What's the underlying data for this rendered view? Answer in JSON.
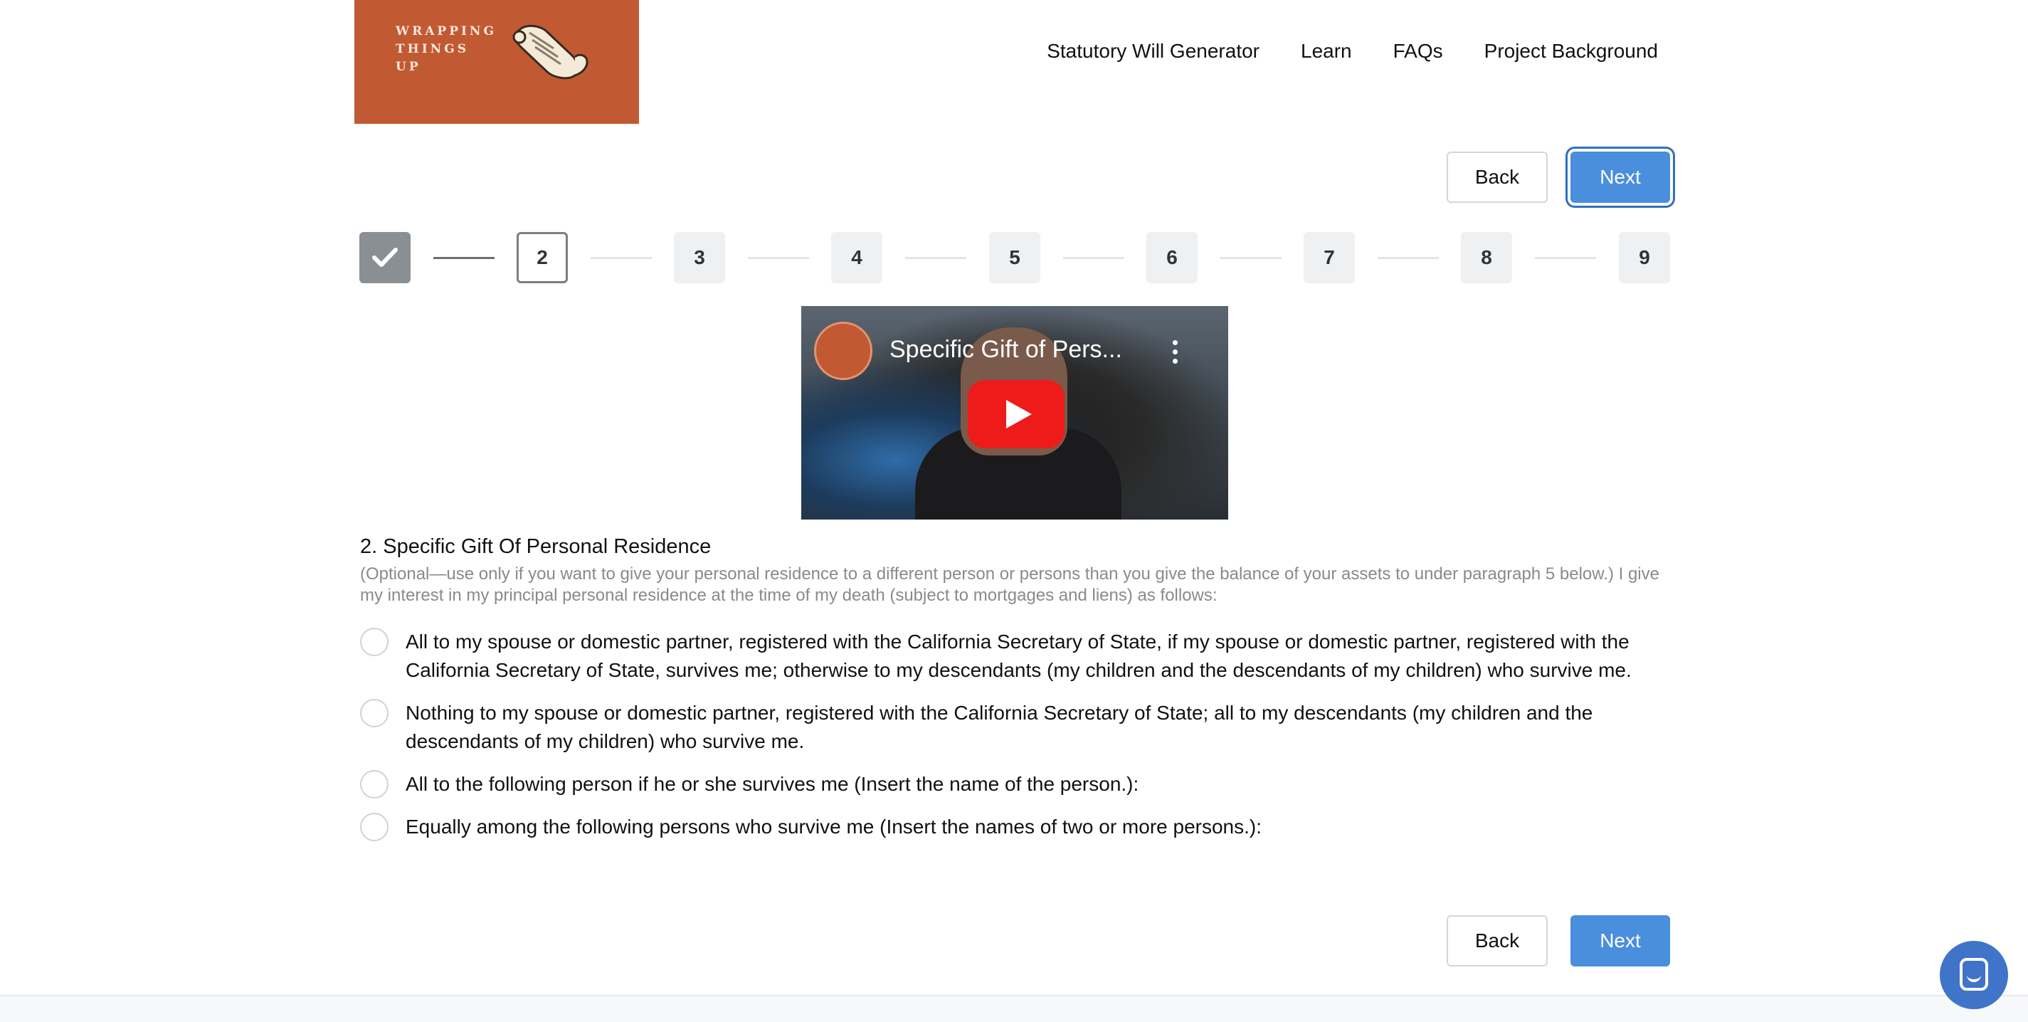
{
  "logo": {
    "line1": "WRAPPING",
    "line2": "THINGS",
    "line3": "UP"
  },
  "nav": {
    "items": [
      {
        "label": "Statutory Will Generator"
      },
      {
        "label": "Learn"
      },
      {
        "label": "FAQs"
      },
      {
        "label": "Project Background"
      }
    ]
  },
  "buttons": {
    "back": "Back",
    "next": "Next"
  },
  "stepper": {
    "steps": [
      "",
      "2",
      "3",
      "4",
      "5",
      "6",
      "7",
      "8",
      "9"
    ],
    "current": 2
  },
  "video": {
    "title": "Specific Gift of Pers..."
  },
  "section": {
    "title": "2. Specific Gift Of Personal Residence",
    "description": "(Optional—use only if you want to give your personal residence to a different person or persons than you give the balance of your assets to under paragraph 5 below.) I give my interest in my principal personal residence at the time of my death (subject to mortgages and liens) as follows:"
  },
  "options": [
    {
      "label": "All to my spouse or domestic partner, registered with the California Secretary of State, if my spouse or domestic partner, registered with the California Secretary of State, survives me; otherwise to my descendants (my children and the descendants of my children) who survive me."
    },
    {
      "label": "Nothing to my spouse or domestic partner, registered with the California Secretary of State; all to my descendants (my children and the descendants of my children) who survive me."
    },
    {
      "label": "All to the following person if he or she survives me (Insert the name of the person.):"
    },
    {
      "label": "Equally among the following persons who survive me (Insert the names of two or more persons.):"
    }
  ],
  "colors": {
    "brand": "#c15a33",
    "primary": "#4a8ede",
    "chat": "#3f74c9"
  },
  "icons": {
    "check": "check-icon",
    "play": "play-icon",
    "chat": "chat-icon",
    "more": "more-vertical-icon"
  }
}
